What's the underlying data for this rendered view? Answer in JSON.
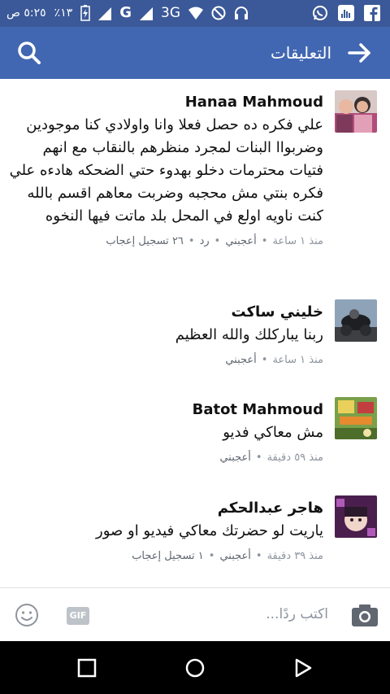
{
  "status_bar": {
    "time": "٥:٢٥ ص",
    "battery": "٪١٣",
    "network_g": "G",
    "network_3g": "3G"
  },
  "toolbar": {
    "title": "التعليقات"
  },
  "comments": [
    {
      "author": "Hanaa Mahmoud",
      "text": "علي فكره ده حصل فعلا وانا واولادي كنا موجودين وضربواا البنات لمجرد منظرهم بالنقاب مع انهم فتيات محترمات دخلو بهدوء حتي الضحكه هادءه علي فكره بنتي مش محجبه وضربت معاهم اقسم بالله كنت ناويه اولع في المحل بلد ماتت فيها النخوه",
      "time": "منذ ١ ساعة",
      "like": "أعجبني",
      "reply": "رد",
      "likes_count": "٢٦ تسجيل إعجاب"
    },
    {
      "author": "خليني ساكت",
      "text": "ربنا يباركلك والله العظيم",
      "time": "منذ ١ ساعة",
      "like": "أعجبني"
    },
    {
      "author": "Batot Mahmoud",
      "text": "مش معاكي فديو",
      "time": "منذ ٥٩ دقيقة",
      "like": "أعجبني"
    },
    {
      "author": "هاجر عبدالحكم",
      "text": "ياريت لو حضرتك معاكي فيديو او صور",
      "time": "منذ ٣٩ دقيقة",
      "like": "أعجبني",
      "likes_count": "١ تسجيل إعجاب"
    }
  ],
  "composer": {
    "placeholder": "اكتب ردًا...",
    "gif_label": "GIF"
  },
  "colors": {
    "status_bar": "#3b5998",
    "toolbar": "#4267b2",
    "meta_text": "#8d949e"
  }
}
